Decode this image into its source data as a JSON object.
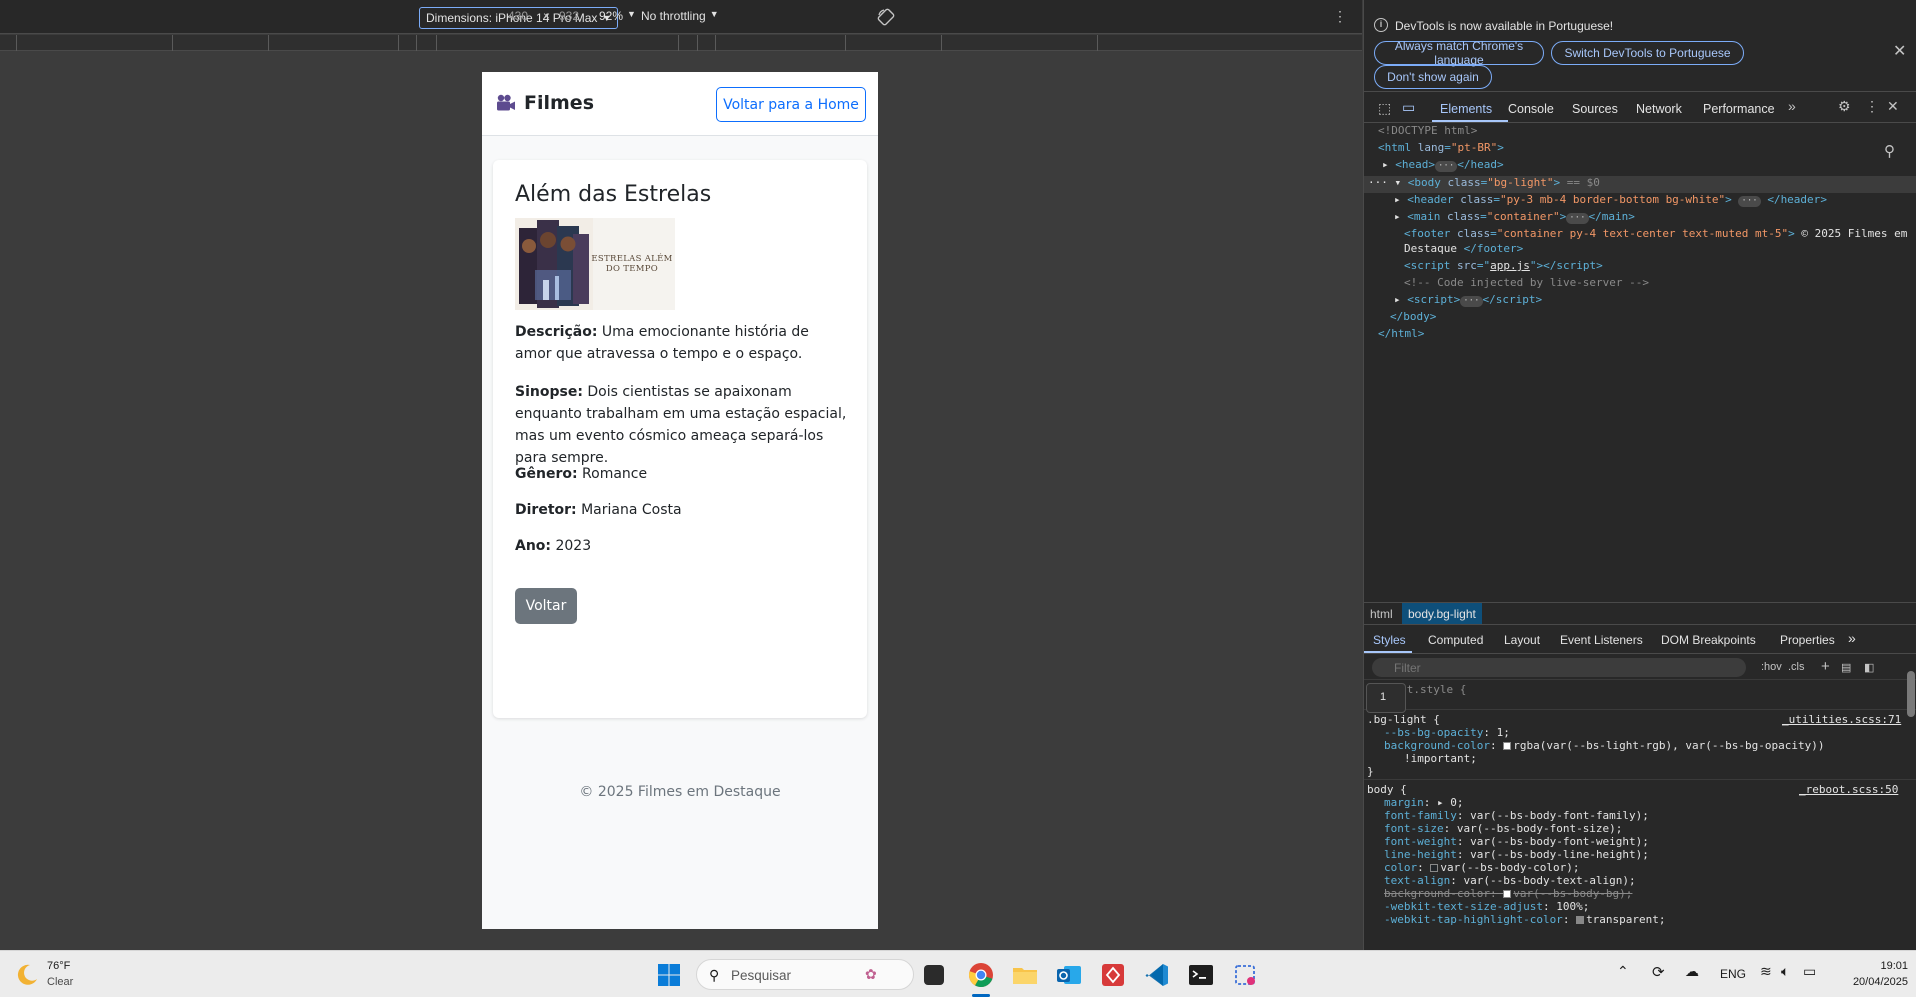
{
  "device_toolbar": {
    "dimensions_label": "Dimensions: iPhone 14 Pro Max",
    "width": "430",
    "times": "×",
    "height": "932",
    "zoom": "92%",
    "throttling": "No throttling"
  },
  "page": {
    "brand": "Filmes",
    "home_button": "Voltar para a Home",
    "movie": {
      "title": "Além das Estrelas",
      "poster_text": "ESTRELAS ALÉM DO TEMPO",
      "descricao_label": "Descrição:",
      "descricao": "Uma emocionante história de amor que atravessa o tempo e o espaço.",
      "sinopse_label": "Sinopse:",
      "sinopse": "Dois cientistas se apaixonam enquanto trabalham em uma estação espacial, mas um evento cósmico ameaça separá-los para sempre.",
      "genero_label": "Gênero:",
      "genero": "Romance",
      "diretor_label": "Diretor:",
      "diretor": "Mariana Costa",
      "ano_label": "Ano:",
      "ano": "2023"
    },
    "back_button": "Voltar",
    "footer": "© 2025 Filmes em Destaque"
  },
  "devtools": {
    "infobar": {
      "message": "DevTools is now available in Portuguese!",
      "btn_match": "Always match Chrome's language",
      "btn_switch": "Switch DevTools to Portuguese",
      "btn_dont": "Don't show again"
    },
    "tabs": [
      "Elements",
      "Console",
      "Sources",
      "Network",
      "Performance"
    ],
    "active_tab": "Elements",
    "dom": {
      "doctype": "<!DOCTYPE html>",
      "html_open_tag": "html",
      "html_lang_attr": "lang",
      "html_lang_val": "\"pt-BR\"",
      "head": "head",
      "body_tag": "body",
      "body_class_attr": "class",
      "body_class_val": "\"bg-light\"",
      "body_eq": "== $0",
      "header_tag": "header",
      "header_class": "\"py-3 mb-4 border-bottom bg-white\"",
      "main_tag": "main",
      "main_class": "\"container\"",
      "footer_tag": "footer",
      "footer_class": "\"container py-4 text-center text-muted mt-5\"",
      "footer_text_1": "© 2025 Filmes em",
      "footer_text_2": "Destaque",
      "script_tag": "script",
      "script_src_attr": "src",
      "script_src_val": "app.js",
      "comment": "<!-- Code injected by live-server -->",
      "body_close": "</body>",
      "html_close": "</html>"
    },
    "breadcrumbs": [
      "html",
      "body.bg-light"
    ],
    "styles_tabs": [
      "Styles",
      "Computed",
      "Layout",
      "Event Listeners",
      "DOM Breakpoints",
      "Properties"
    ],
    "active_styles_tab": "Styles",
    "filter_placeholder": "Filter",
    "filter_tools": [
      ":hov",
      ".cls"
    ],
    "tooltip_value": "1",
    "styles": {
      "element_style": "element.style {",
      "brace_close": "}",
      "rule1_selector": ".bg-light {",
      "rule1_source": "_utilities.scss:71",
      "rule1_p1_name": "--bs-bg-opacity",
      "rule1_p1_val": "1;",
      "rule1_p2_name": "background-color",
      "rule1_p2_val": "rgba(var(--bs-light-rgb), var(--bs-bg-opacity))",
      "rule1_p2_imp": "!important;",
      "rule2_selector": "body {",
      "rule2_source": "_reboot.scss:50",
      "rule2_props": [
        {
          "name": "margin",
          "val": "▸ 0;"
        },
        {
          "name": "font-family",
          "val": "var(--bs-body-font-family);"
        },
        {
          "name": "font-size",
          "val": "var(--bs-body-font-size);"
        },
        {
          "name": "font-weight",
          "val": "var(--bs-body-font-weight);"
        },
        {
          "name": "line-height",
          "val": "var(--bs-body-line-height);"
        },
        {
          "name": "color",
          "val": "var(--bs-body-color);"
        },
        {
          "name": "text-align",
          "val": "var(--bs-body-text-align);"
        },
        {
          "name": "background-color",
          "val": "var(--bs-body-bg);"
        },
        {
          "name": "-webkit-text-size-adjust",
          "val": "100%;"
        },
        {
          "name": "-webkit-tap-highlight-color",
          "val": "transparent;"
        }
      ]
    }
  },
  "taskbar": {
    "temperature": "76°F",
    "condition": "Clear",
    "search_label": "Pesquisar",
    "language": "ENG",
    "time": "19:01",
    "date": "20/04/2025"
  },
  "colors": {
    "primary": "#0d6efd",
    "secondary": "#6c757d",
    "devtools_accent": "#a8c7fa"
  }
}
